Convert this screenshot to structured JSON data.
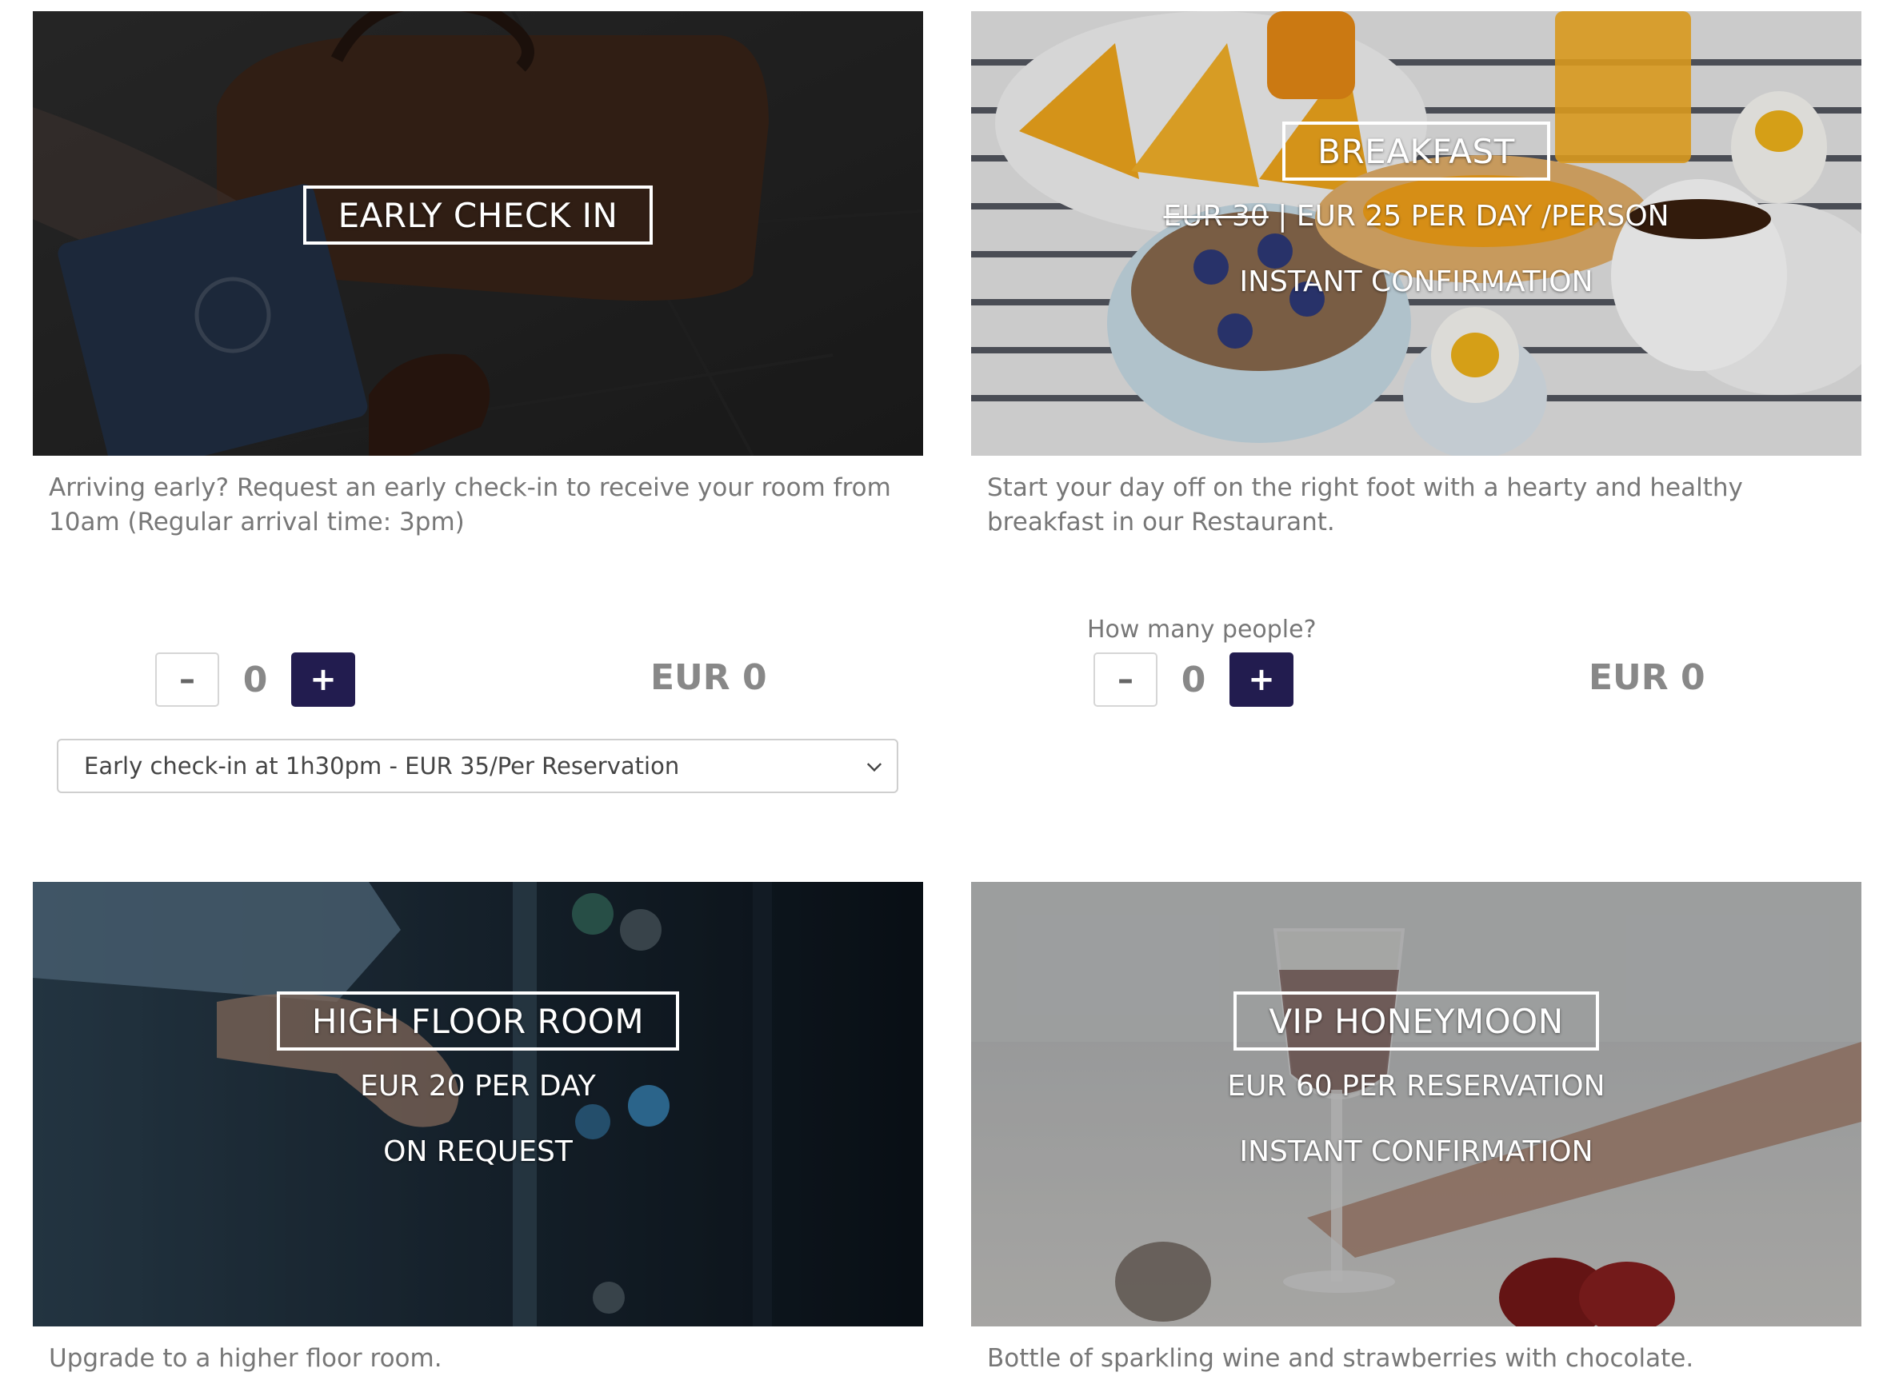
{
  "cards": {
    "early_check_in": {
      "title": "EARLY CHECK IN",
      "description": "Arriving early? Request an early check-in to receive your room from 10am (Regular arrival time: 3pm)",
      "quantity": "0",
      "price": "EUR 0",
      "minus_label": "–",
      "plus_label": "+",
      "select_value": "Early check-in at 1h30pm - EUR 35/Per Reservation"
    },
    "breakfast": {
      "title": "BREAKFAST",
      "old_price": "EUR 30",
      "separator": " | ",
      "price_line": "EUR 25 PER DAY /PERSON",
      "confirmation": "INSTANT CONFIRMATION",
      "description": "Start your day off on the right foot with a hearty and healthy breakfast in our Restaurant.",
      "quantity_label": "How many people?",
      "quantity": "0",
      "price": "EUR 0",
      "minus_label": "–",
      "plus_label": "+"
    },
    "high_floor_room": {
      "title": "HIGH FLOOR ROOM",
      "price_line": "EUR 20 PER DAY",
      "confirmation": "ON REQUEST",
      "description": "Upgrade to a higher floor room."
    },
    "vip_honeymoon": {
      "title": "VIP HONEYMOON",
      "price_line": "EUR 60 PER RESERVATION",
      "confirmation": "INSTANT CONFIRMATION",
      "description": "Bottle of sparkling wine and strawberries with chocolate."
    }
  },
  "colors": {
    "accent": "#221c4f",
    "text": "#777777",
    "price": "#888888"
  },
  "icons": {
    "select_arrow": "chevron-down-icon"
  }
}
